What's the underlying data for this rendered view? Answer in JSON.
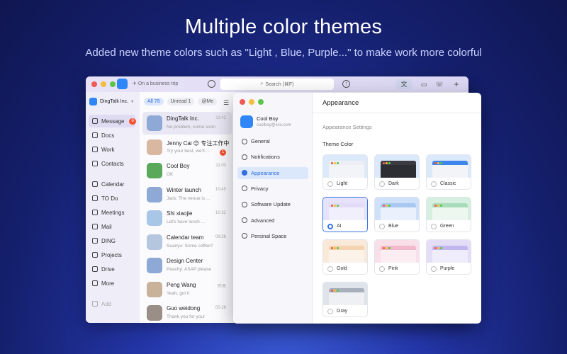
{
  "headline": "Multiple color themes",
  "subline": "Added new theme colors such as \"Light , Blue, Purple...\" to make work more colorful",
  "main_window": {
    "status": "On a business trip",
    "search_label": "Search (⌘F)",
    "org_name": "DingTalk Inc.",
    "nav": [
      {
        "label": "Message",
        "badge": "6",
        "icon": "message-icon"
      },
      {
        "label": "Docs",
        "icon": "docs-icon"
      },
      {
        "label": "Work",
        "icon": "work-grid-icon"
      },
      {
        "label": "Contacts",
        "icon": "contacts-icon"
      },
      {
        "label": "Calendar",
        "icon": "calendar-icon"
      },
      {
        "label": "TO Do",
        "icon": "todo-icon"
      },
      {
        "label": "Meetings",
        "icon": "meetings-icon"
      },
      {
        "label": "Mail",
        "icon": "mail-icon"
      },
      {
        "label": "DING",
        "icon": "ding-icon"
      },
      {
        "label": "Projects",
        "icon": "projects-icon"
      },
      {
        "label": "Drive",
        "icon": "drive-icon"
      },
      {
        "label": "More",
        "icon": "more-icon"
      },
      {
        "label": "Add",
        "icon": "add-icon"
      }
    ],
    "filters": [
      "All 78",
      "Unread 1",
      "@Me"
    ],
    "chats": [
      {
        "name": "DingTalk Inc.",
        "preview": "No problem, come soon",
        "time": "11:42",
        "color": "#8fa9d6"
      },
      {
        "name": "Jenny Cai 😊 专注工作中",
        "preview": "Try your best, we'll ...",
        "time": "",
        "unread": "1",
        "color": "#d8b8a0"
      },
      {
        "name": "Cool Boy",
        "preview": "OK",
        "time": "11:03",
        "color": "#5aa95a"
      },
      {
        "name": "Winter launch",
        "preview": "Jack: The venue is ...",
        "time": "10:45",
        "color": "#8fa9d6"
      },
      {
        "name": "Shi xiaojie",
        "preview": "Let's have lunch ...",
        "time": "10:32",
        "color": "#a8c6e6"
      },
      {
        "name": "Calendar team",
        "preview": "Suanyu: Some coffee?",
        "time": "09:28",
        "color": "#b4c7de"
      },
      {
        "name": "Design Center",
        "preview": "Peachy: ASAP please",
        "time": "",
        "color": "#8fa9d6"
      },
      {
        "name": "Peng Wang",
        "preview": "Yeah, got it",
        "time": "昨天",
        "color": "#c9b29a"
      },
      {
        "name": "Guo weidong",
        "preview": "Thank you for your",
        "time": "05-28",
        "color": "#9a8f86"
      }
    ]
  },
  "settings": {
    "profile_name": "Cool Boy",
    "profile_email": "coolboy@xxx.com",
    "menu": [
      {
        "label": "General",
        "icon": "general-icon"
      },
      {
        "label": "Notifications",
        "icon": "bell-icon"
      },
      {
        "label": "Appearance",
        "icon": "appearance-icon",
        "active": true
      },
      {
        "label": "Privacy",
        "icon": "privacy-icon"
      },
      {
        "label": "Software Update",
        "icon": "update-icon"
      },
      {
        "label": "Advanced",
        "icon": "advanced-icon"
      },
      {
        "label": "Persinal Space",
        "icon": "space-icon"
      }
    ],
    "title": "Appearance",
    "section_title": "Appearance Settings",
    "theme_label": "Theme Color",
    "themes": [
      {
        "name": "Light",
        "bg": "#dce9fb",
        "bar": "#eceef4",
        "win": "#f3f4f7"
      },
      {
        "name": "Dark",
        "bg": "#dce9fb",
        "bar": "#3a3c42",
        "win": "#2c2e33"
      },
      {
        "name": "Classic",
        "bg": "#dce9fb",
        "bar": "#3d86ee",
        "win": "#f3f4f7"
      },
      {
        "name": "AI",
        "bg": "#e5e2fa",
        "bar": "#e2dcf8",
        "win": "#f1effb",
        "selected": true
      },
      {
        "name": "Blue",
        "bg": "#cfe0f9",
        "bar": "#a8c8f2",
        "win": "#eaf1fc"
      },
      {
        "name": "Green",
        "bg": "#d7efe0",
        "bar": "#a9dcb9",
        "win": "#edf7f0"
      },
      {
        "name": "Gold",
        "bg": "#f8e9d8",
        "bar": "#f3d3b0",
        "win": "#fbf3ea"
      },
      {
        "name": "Pink",
        "bg": "#f9e0e8",
        "bar": "#f2b8cc",
        "win": "#fcedf2"
      },
      {
        "name": "Purple",
        "bg": "#e3ddf7",
        "bar": "#c2b6ee",
        "win": "#efecfb"
      },
      {
        "name": "Gray",
        "bg": "#dfe3ea",
        "bar": "#a9b0bd",
        "win": "#eef0f3"
      }
    ]
  }
}
